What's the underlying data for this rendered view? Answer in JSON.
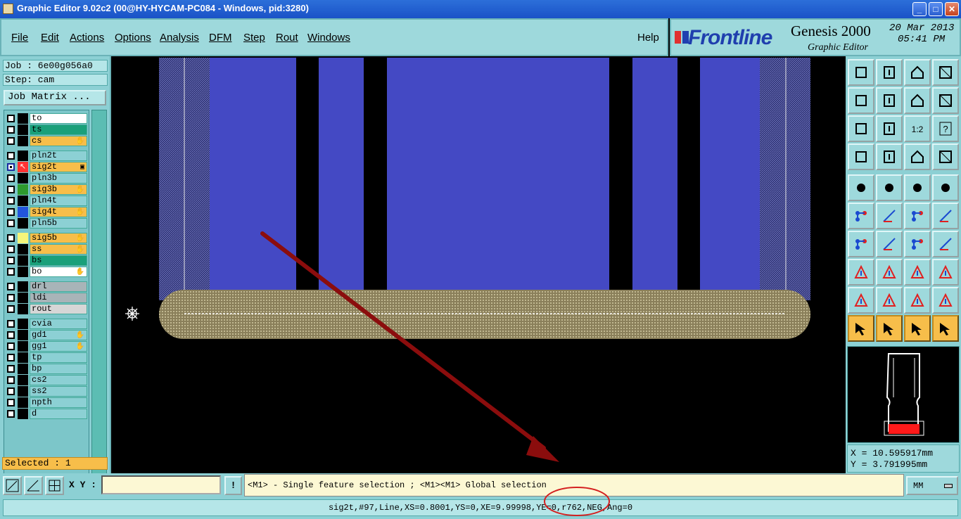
{
  "window": {
    "title": "Graphic Editor 9.02c2 (00@HY-HYCAM-PC084 - Windows, pid:3280)",
    "minimize": "_",
    "maximize": "□",
    "close": "✕"
  },
  "menu": {
    "items": [
      "File",
      "Edit",
      "Actions",
      "Options",
      "Analysis",
      "DFM",
      "Step",
      "Rout",
      "Windows"
    ],
    "help": "Help"
  },
  "branding": {
    "logo": "Frontline",
    "product": "Genesis 2000",
    "subtitle": "Graphic Editor",
    "date": "20 Mar 2013",
    "time": "05:41 PM"
  },
  "job": {
    "job_label": "Job : 6e00g056a0",
    "step_label": "Step: cam",
    "matrix_button": "Job Matrix ..."
  },
  "layers": [
    {
      "name": "to",
      "bg": "#ffffff",
      "swatch": "#000000",
      "mark": ""
    },
    {
      "name": "ts",
      "bg": "#1aa07a",
      "swatch": "#000000",
      "mark": ""
    },
    {
      "name": "cs",
      "bg": "#f7be4a",
      "swatch": "#000000",
      "mark": "✋"
    },
    {
      "name": "pln2t",
      "bg": "#8cd0d4",
      "swatch": "#000000",
      "mark": ""
    },
    {
      "name": "sig2t",
      "bg": "#f7be4a",
      "swatch": "#ff3333",
      "mark": "▣",
      "work": true
    },
    {
      "name": "pln3b",
      "bg": "#8cd0d4",
      "swatch": "#000000",
      "mark": ""
    },
    {
      "name": "sig3b",
      "bg": "#f7be4a",
      "swatch": "#2e9a2e",
      "mark": "✋"
    },
    {
      "name": "pln4t",
      "bg": "#8cd0d4",
      "swatch": "#000000",
      "mark": ""
    },
    {
      "name": "sig4t",
      "bg": "#f7be4a",
      "swatch": "#2255dd",
      "mark": "✋"
    },
    {
      "name": "pln5b",
      "bg": "#8cd0d4",
      "swatch": "#000000",
      "mark": ""
    },
    {
      "name": "sig5b",
      "bg": "#f7be4a",
      "swatch": "#f5f57a",
      "mark": "✋"
    },
    {
      "name": "ss",
      "bg": "#f7be4a",
      "swatch": "#000000",
      "mark": "✋"
    },
    {
      "name": "bs",
      "bg": "#1aa07a",
      "swatch": "#000000",
      "mark": ""
    },
    {
      "name": "bo",
      "bg": "#ffffff",
      "swatch": "#000000",
      "mark": "✋"
    },
    {
      "name": "drl",
      "bg": "#a8b4b8",
      "swatch": "#000000",
      "mark": ""
    },
    {
      "name": "ldi",
      "bg": "#a8b4b8",
      "swatch": "#000000",
      "mark": ""
    },
    {
      "name": "rout",
      "bg": "#d6d6d6",
      "swatch": "#000000",
      "mark": ""
    },
    {
      "name": "cvia",
      "bg": "#8cd0d4",
      "swatch": "#000000",
      "mark": ""
    },
    {
      "name": "gd1",
      "bg": "#8cd0d4",
      "swatch": "#000000",
      "mark": "✋"
    },
    {
      "name": "gg1",
      "bg": "#8cd0d4",
      "swatch": "#000000",
      "mark": "✋"
    },
    {
      "name": "tp",
      "bg": "#8cd0d4",
      "swatch": "#000000",
      "mark": ""
    },
    {
      "name": "bp",
      "bg": "#8cd0d4",
      "swatch": "#000000",
      "mark": ""
    },
    {
      "name": "cs2",
      "bg": "#8cd0d4",
      "swatch": "#000000",
      "mark": ""
    },
    {
      "name": "ss2",
      "bg": "#8cd0d4",
      "swatch": "#000000",
      "mark": ""
    },
    {
      "name": "npth",
      "bg": "#8cd0d4",
      "swatch": "#000000",
      "mark": ""
    },
    {
      "name": "d",
      "bg": "#8cd0d4",
      "swatch": "#000000",
      "mark": ""
    }
  ],
  "selection": {
    "label": "Selected : 1"
  },
  "coords": {
    "x": "X = 10.595917mm",
    "y": "Y = 3.791995mm"
  },
  "input": {
    "xy_label": "X Y :",
    "xy_value": "",
    "excl": "!"
  },
  "hint": "<M1> - Single feature selection ; <M1><M1> Global selection",
  "units": "MM",
  "status": "sig2t,#97,Line,XS=0.8001,YS=0,XE=9.99998,YE=0,r762,NEG,Ang=0",
  "tool_icons": [
    "zoom-home-icon",
    "zoom-window-icon",
    "home-icon",
    "zoom-xy-icon",
    "pan-left-icon",
    "pan-right-icon",
    "undo-zoom-icon",
    "redraw-icon",
    "fit-icon",
    "center-icon",
    "scale-1-2-label",
    "help-icon",
    "settings-icon",
    "grid-icon",
    "snap-icon",
    "snap-active-icon",
    "pad-icon",
    "polygon-icon",
    "ruler-icon",
    "dot-icon",
    "connect-icon",
    "delete-icon",
    "move-node-icon",
    "line-node-icon",
    "angle-icon",
    "slash-icon",
    "arc-icon",
    "mirror-icon",
    "measure-icon",
    "line-icon",
    "resize-icon",
    "copy-icon",
    "tri-a-icon",
    "tri-b-icon",
    "tri-c-icon",
    "tri-d-icon",
    "select-arrow-icon",
    "select-box-icon",
    "select-circle-icon",
    "select-path-icon"
  ],
  "colors": {
    "panel": "#8cd0d4",
    "highlight": "#f7be4a",
    "trace_fill": "#4a52d0"
  }
}
